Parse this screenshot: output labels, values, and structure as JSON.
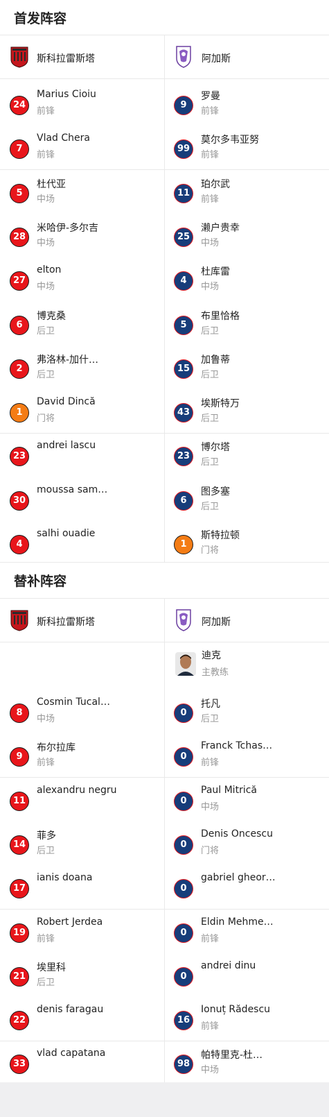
{
  "starting": {
    "title": "首发阵容",
    "home_team": "斯科拉雷斯塔",
    "away_team": "阿加斯",
    "home": [
      {
        "num": "24",
        "name": "Marius Cioiu",
        "pos": "前锋",
        "color": "red"
      },
      {
        "num": "7",
        "name": "Vlad Chera",
        "pos": "前锋",
        "color": "red"
      },
      {
        "num": "5",
        "name": "杜代亚",
        "pos": "中场",
        "color": "red"
      },
      {
        "num": "28",
        "name": "米哈伊-多尔吉",
        "pos": "中场",
        "color": "red"
      },
      {
        "num": "27",
        "name": "elton",
        "pos": "中场",
        "color": "red"
      },
      {
        "num": "6",
        "name": "博克桑",
        "pos": "后卫",
        "color": "red"
      },
      {
        "num": "2",
        "name": "弗洛林-加什…",
        "pos": "后卫",
        "color": "red"
      },
      {
        "num": "1",
        "name": "David Dincă",
        "pos": "门将",
        "color": "orange"
      },
      {
        "num": "23",
        "name": "andrei lascu",
        "pos": "",
        "color": "red"
      },
      {
        "num": "30",
        "name": "moussa sam…",
        "pos": "",
        "color": "red"
      },
      {
        "num": "4",
        "name": "salhi ouadie",
        "pos": "",
        "color": "red"
      }
    ],
    "away": [
      {
        "num": "9",
        "name": "罗曼",
        "pos": "前锋",
        "color": "blue"
      },
      {
        "num": "99",
        "name": "莫尔多韦亚努",
        "pos": "前锋",
        "color": "blue"
      },
      {
        "num": "11",
        "name": "珀尔武",
        "pos": "前锋",
        "color": "blue"
      },
      {
        "num": "25",
        "name": "濑户贵幸",
        "pos": "中场",
        "color": "blue"
      },
      {
        "num": "4",
        "name": "杜库雷",
        "pos": "中场",
        "color": "blue"
      },
      {
        "num": "5",
        "name": "布里恰格",
        "pos": "后卫",
        "color": "blue"
      },
      {
        "num": "15",
        "name": "加鲁蒂",
        "pos": "后卫",
        "color": "blue"
      },
      {
        "num": "43",
        "name": "埃斯特万",
        "pos": "后卫",
        "color": "blue"
      },
      {
        "num": "23",
        "name": "博尔塔",
        "pos": "后卫",
        "color": "blue"
      },
      {
        "num": "6",
        "name": "图多塞",
        "pos": "后卫",
        "color": "blue"
      },
      {
        "num": "1",
        "name": "斯特拉顿",
        "pos": "门将",
        "color": "orange"
      }
    ]
  },
  "subs": {
    "title": "替补阵容",
    "home_team": "斯科拉雷斯塔",
    "away_team": "阿加斯",
    "coach": {
      "name": "迪克",
      "role": "主教练"
    },
    "home": [
      {
        "num": "8",
        "name": "Cosmin Tucal…",
        "pos": "中场",
        "color": "red"
      },
      {
        "num": "9",
        "name": "布尔拉库",
        "pos": "前锋",
        "color": "red"
      },
      {
        "num": "11",
        "name": "alexandru negru",
        "pos": "",
        "color": "red"
      },
      {
        "num": "14",
        "name": "菲多",
        "pos": "后卫",
        "color": "red"
      },
      {
        "num": "17",
        "name": "ianis doana",
        "pos": "",
        "color": "red"
      },
      {
        "num": "19",
        "name": "Robert Jerdea",
        "pos": "前锋",
        "color": "red"
      },
      {
        "num": "21",
        "name": "埃里科",
        "pos": "后卫",
        "color": "red"
      },
      {
        "num": "22",
        "name": "denis faragau",
        "pos": "",
        "color": "red"
      },
      {
        "num": "33",
        "name": "vlad capatana",
        "pos": "",
        "color": "red"
      }
    ],
    "away": [
      {
        "num": "0",
        "name": "托凡",
        "pos": "后卫",
        "color": "blue"
      },
      {
        "num": "0",
        "name": "Franck Tchas…",
        "pos": "前锋",
        "color": "blue"
      },
      {
        "num": "0",
        "name": "Paul Mitrică",
        "pos": "中场",
        "color": "blue"
      },
      {
        "num": "0",
        "name": "Denis Oncescu",
        "pos": "门将",
        "color": "blue"
      },
      {
        "num": "0",
        "name": "gabriel gheor…",
        "pos": "",
        "color": "blue"
      },
      {
        "num": "0",
        "name": "Eldin Mehme…",
        "pos": "前锋",
        "color": "blue"
      },
      {
        "num": "0",
        "name": "andrei dinu",
        "pos": "",
        "color": "blue"
      },
      {
        "num": "16",
        "name": "Ionuț Rădescu",
        "pos": "前锋",
        "color": "blue"
      },
      {
        "num": "98",
        "name": "帕特里克-杜…",
        "pos": "中场",
        "color": "blue"
      }
    ]
  },
  "colors": {
    "home_badge": "#e8161b",
    "away_badge": "#173d7a",
    "keeper_badge": "#f47c15"
  },
  "icons": {
    "home_logo": "sepsi-crest-icon",
    "away_logo": "fc-arges-crest-icon"
  }
}
